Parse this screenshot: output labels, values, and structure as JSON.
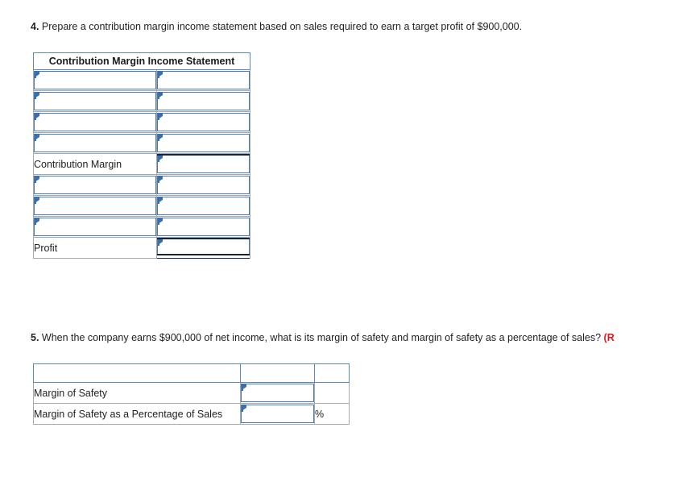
{
  "questions": {
    "q4": {
      "number": "4.",
      "text": " Prepare a contribution margin income statement based on sales required to earn a target profit of $900,000."
    },
    "q5": {
      "number": "5.",
      "text": " When the company earns $900,000 of net income, what is its margin of safety and margin of safety as a percentage of sales? ",
      "red_suffix": "(R"
    }
  },
  "colors": {
    "header_blue": "#79a7dd",
    "header_border": "#5b87b5",
    "input_border": "#4a7ab0",
    "flag_blue": "#3a6fae",
    "grid_border": "#a8a8a8",
    "total_rule": "#15243a",
    "text": "#1f1f1f",
    "red_text": "#d91b1b"
  },
  "table_cmis": {
    "title": "Contribution Margin Income Statement",
    "rows": [
      {
        "label": "",
        "label_is_input": true,
        "value": "",
        "rule_top": false,
        "rule_bottom": false
      },
      {
        "label": "",
        "label_is_input": true,
        "value": "",
        "rule_top": false,
        "rule_bottom": false
      },
      {
        "label": "",
        "label_is_input": true,
        "value": "",
        "rule_top": false,
        "rule_bottom": false
      },
      {
        "label": "",
        "label_is_input": true,
        "value": "",
        "rule_top": false,
        "rule_bottom": false
      },
      {
        "label": "Contribution Margin",
        "label_is_input": false,
        "value": "",
        "rule_top": true,
        "rule_bottom": false
      },
      {
        "label": "",
        "label_is_input": true,
        "value": "",
        "rule_top": false,
        "rule_bottom": false
      },
      {
        "label": "",
        "label_is_input": true,
        "value": "",
        "rule_top": false,
        "rule_bottom": false
      },
      {
        "label": "",
        "label_is_input": true,
        "value": "",
        "rule_top": false,
        "rule_bottom": false
      },
      {
        "label": "Profit",
        "label_is_input": false,
        "value": "",
        "rule_top": true,
        "rule_bottom": true
      }
    ]
  },
  "table_mos": {
    "header": {
      "c1": "",
      "c2": "",
      "c3": ""
    },
    "rows": [
      {
        "label": "Margin of Safety",
        "value": "",
        "unit": ""
      },
      {
        "label": "Margin of Safety as a Percentage of Sales",
        "value": "",
        "unit": "%"
      }
    ]
  }
}
